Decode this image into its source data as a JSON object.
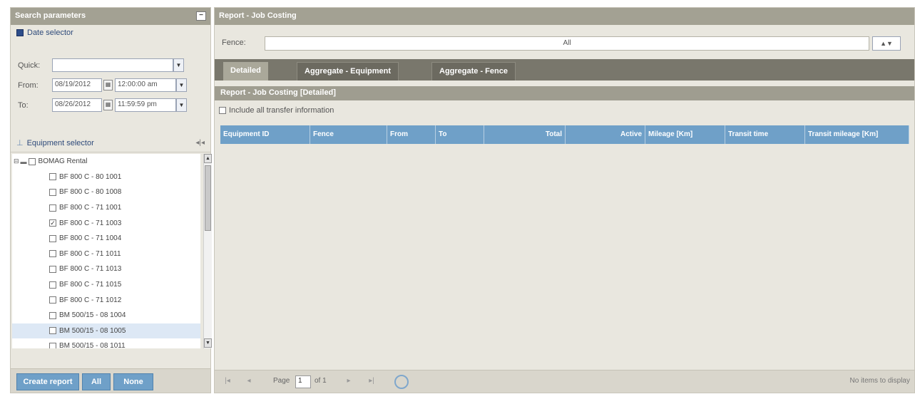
{
  "left_panel": {
    "title": "Search parameters",
    "collapse_icon": "minus-icon",
    "date_selector": {
      "label": "Date selector",
      "quick_label": "Quick:",
      "quick_value": "",
      "from_label": "From:",
      "from_date": "08/19/2012",
      "from_time": "12:00:00 am",
      "to_label": "To:",
      "to_date": "08/26/2012",
      "to_time": "11:59:59 pm"
    },
    "equipment_selector": {
      "label": "Equipment selector",
      "root": "BOMAG Rental",
      "items": [
        {
          "label": "BF 800 C - 80 1001",
          "checked": false
        },
        {
          "label": "BF 800 C - 80 1008",
          "checked": false
        },
        {
          "label": "BF 800 C - 71 1001",
          "checked": false
        },
        {
          "label": "BF 800 C - 71 1003",
          "checked": true
        },
        {
          "label": "BF 800 C - 71 1004",
          "checked": false
        },
        {
          "label": "BF 800 C - 71 1011",
          "checked": false
        },
        {
          "label": "BF 800 C - 71 1013",
          "checked": false
        },
        {
          "label": "BF 800 C - 71 1015",
          "checked": false
        },
        {
          "label": "BF 800 C - 71 1012",
          "checked": false
        },
        {
          "label": "BM 500/15 - 08 1004",
          "checked": false
        },
        {
          "label": "BM 500/15 - 08 1005",
          "checked": false
        },
        {
          "label": "BM 500/15 - 08 1011",
          "checked": false
        }
      ]
    },
    "buttons": {
      "create": "Create report",
      "all": "All",
      "none": "None"
    }
  },
  "right_panel": {
    "title": "Report - Job Costing",
    "fence_label": "Fence:",
    "fence_value": "All",
    "tabs": [
      "Detailed",
      "Aggregate - Equipment",
      "Aggregate - Fence"
    ],
    "report_title": "Report - Job Costing [Detailed]",
    "include_transfer": "Include all transfer information",
    "columns": [
      "Equipment ID",
      "Fence",
      "From",
      "To",
      "Total",
      "Active",
      "Mileage [Km]",
      "Transit time",
      "Transit mileage [Km]"
    ],
    "pager": {
      "page_label": "Page",
      "page_value": "1",
      "of_label": "of 1",
      "no_items": "No items to display"
    }
  },
  "colors": {
    "header": "#a3a193",
    "tabbar": "#79776c",
    "grid_header": "#6fa0c8",
    "panel_bg": "#e9e7df"
  }
}
